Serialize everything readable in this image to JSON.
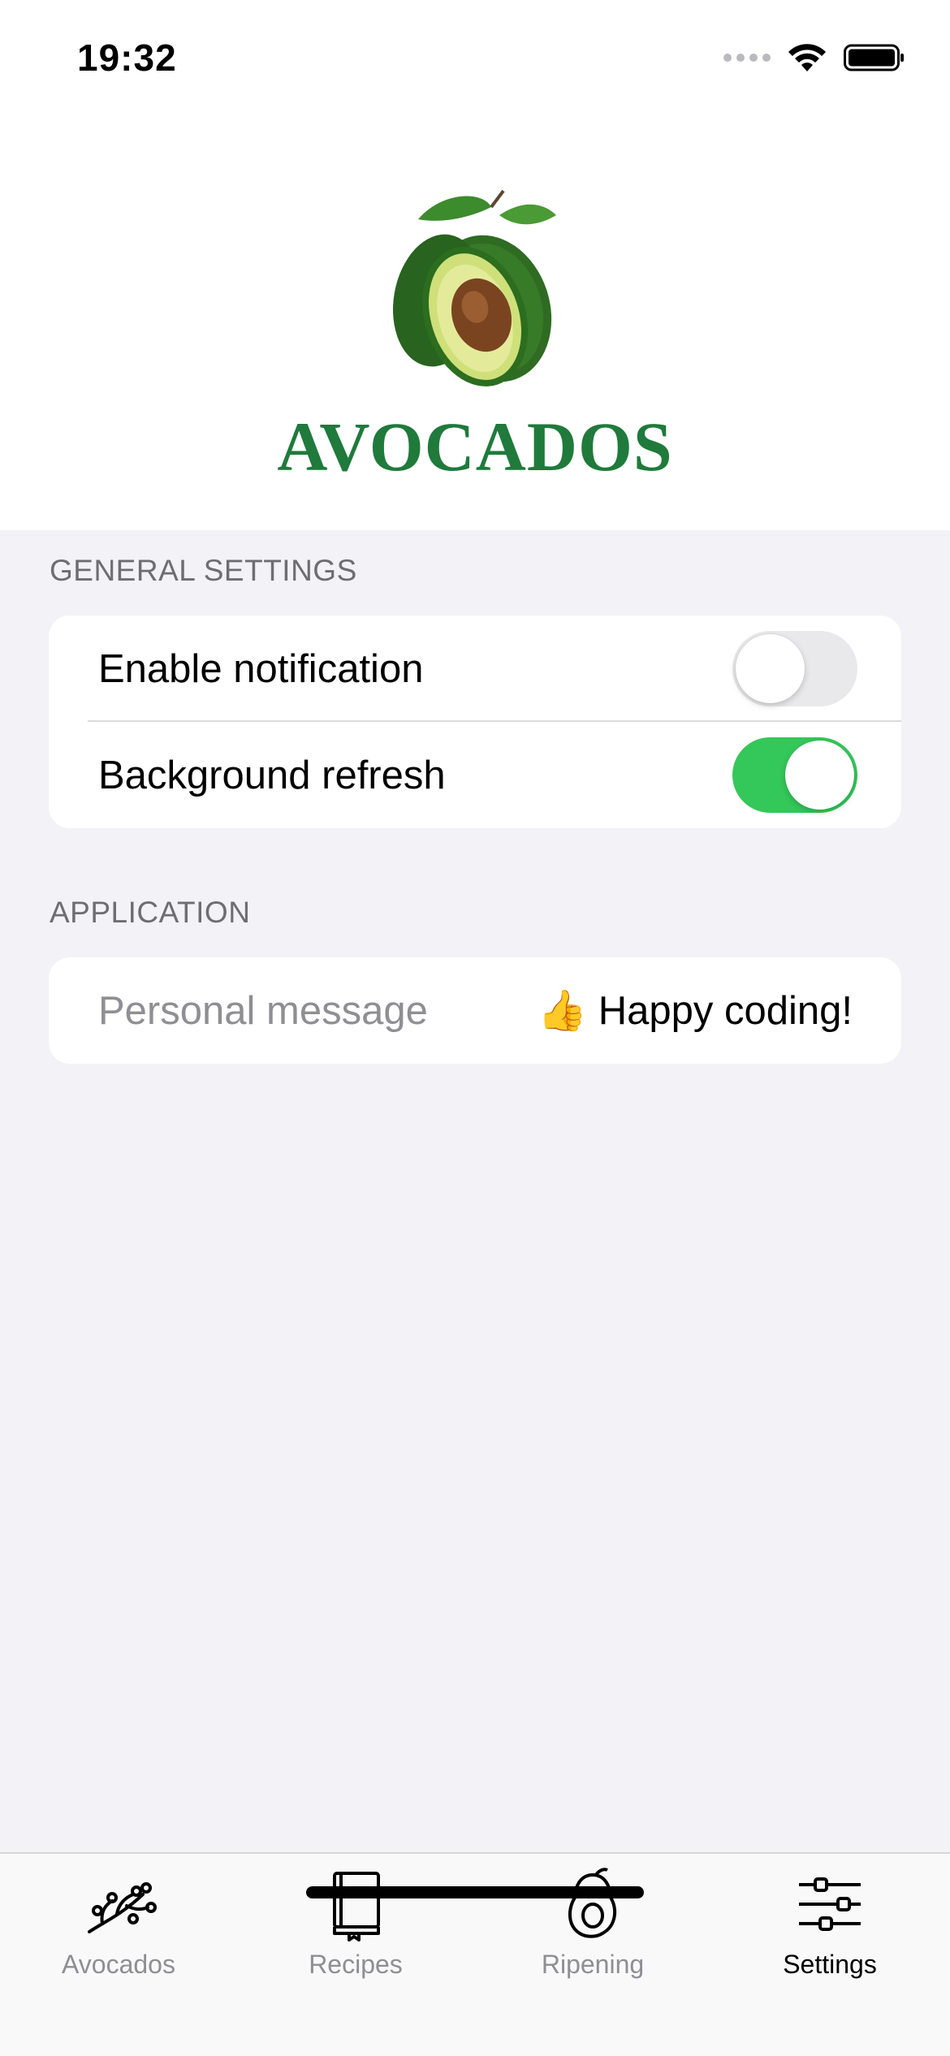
{
  "status_bar": {
    "time": "19:32"
  },
  "header": {
    "title": "AVOCADOS",
    "logo_icon": "avocado-illustration"
  },
  "sections": [
    {
      "header": "GENERAL SETTINGS",
      "rows": [
        {
          "label": "Enable notification",
          "toggle": false
        },
        {
          "label": "Background refresh",
          "toggle": true
        }
      ]
    },
    {
      "header": "APPLICATION",
      "rows": [
        {
          "label": "Personal message",
          "value": "👍 Happy coding!"
        }
      ]
    }
  ],
  "tab_bar": {
    "tabs": [
      {
        "label": "Avocados",
        "icon": "branch-icon",
        "active": false
      },
      {
        "label": "Recipes",
        "icon": "book-icon",
        "active": false
      },
      {
        "label": "Ripening",
        "icon": "avocado-icon",
        "active": false
      },
      {
        "label": "Settings",
        "icon": "sliders-icon",
        "active": true
      }
    ]
  },
  "colors": {
    "brand_green": "#1f7a3b",
    "toggle_on": "#34c759",
    "toggle_off": "#e9e9eb",
    "background": "#f2f2f7"
  }
}
